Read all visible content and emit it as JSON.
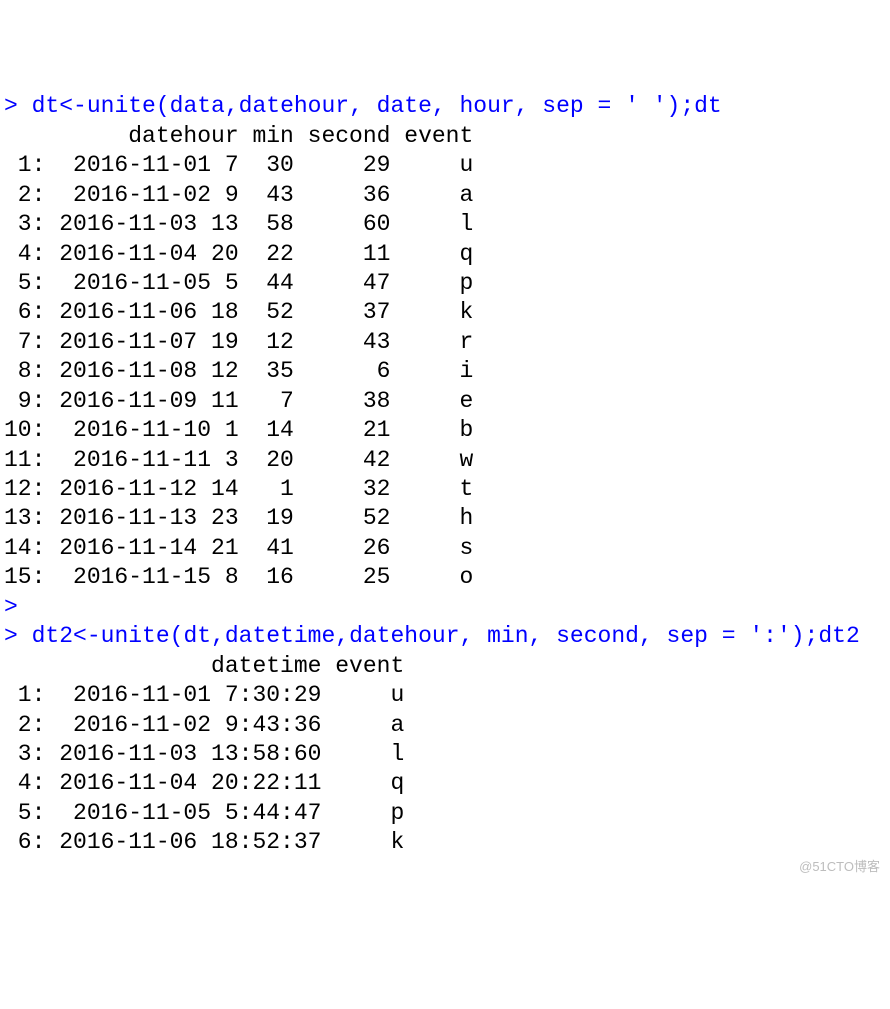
{
  "console": {
    "prompt": ">",
    "cmd1": "dt<-unite(data,datehour, date, hour, sep = ' ');dt",
    "header1": "         datehour min second event",
    "rows1": [
      {
        "idx": " 1:",
        "datehour": "  2016-11-01 7",
        "min": "30",
        "second": "29",
        "event": "u"
      },
      {
        "idx": " 2:",
        "datehour": "  2016-11-02 9",
        "min": "43",
        "second": "36",
        "event": "a"
      },
      {
        "idx": " 3:",
        "datehour": " 2016-11-03 13",
        "min": "58",
        "second": "60",
        "event": "l"
      },
      {
        "idx": " 4:",
        "datehour": " 2016-11-04 20",
        "min": "22",
        "second": "11",
        "event": "q"
      },
      {
        "idx": " 5:",
        "datehour": "  2016-11-05 5",
        "min": "44",
        "second": "47",
        "event": "p"
      },
      {
        "idx": " 6:",
        "datehour": " 2016-11-06 18",
        "min": "52",
        "second": "37",
        "event": "k"
      },
      {
        "idx": " 7:",
        "datehour": " 2016-11-07 19",
        "min": "12",
        "second": "43",
        "event": "r"
      },
      {
        "idx": " 8:",
        "datehour": " 2016-11-08 12",
        "min": "35",
        "second": " 6",
        "event": "i"
      },
      {
        "idx": " 9:",
        "datehour": " 2016-11-09 11",
        "min": " 7",
        "second": "38",
        "event": "e"
      },
      {
        "idx": "10:",
        "datehour": "  2016-11-10 1",
        "min": "14",
        "second": "21",
        "event": "b"
      },
      {
        "idx": "11:",
        "datehour": "  2016-11-11 3",
        "min": "20",
        "second": "42",
        "event": "w"
      },
      {
        "idx": "12:",
        "datehour": " 2016-11-12 14",
        "min": " 1",
        "second": "32",
        "event": "t"
      },
      {
        "idx": "13:",
        "datehour": " 2016-11-13 23",
        "min": "19",
        "second": "52",
        "event": "h"
      },
      {
        "idx": "14:",
        "datehour": " 2016-11-14 21",
        "min": "41",
        "second": "26",
        "event": "s"
      },
      {
        "idx": "15:",
        "datehour": "  2016-11-15 8",
        "min": "16",
        "second": "25",
        "event": "o"
      }
    ],
    "cmd2": "dt2<-unite(dt,datetime,datehour, min, second, sep = ':');dt2",
    "header2": "               datetime event",
    "rows2": [
      {
        "idx": " 1:",
        "datetime": "  2016-11-01 7:30:29",
        "event": "u"
      },
      {
        "idx": " 2:",
        "datetime": "  2016-11-02 9:43:36",
        "event": "a"
      },
      {
        "idx": " 3:",
        "datetime": " 2016-11-03 13:58:60",
        "event": "l"
      },
      {
        "idx": " 4:",
        "datetime": " 2016-11-04 20:22:11",
        "event": "q"
      },
      {
        "idx": " 5:",
        "datetime": "  2016-11-05 5:44:47",
        "event": "p"
      },
      {
        "idx": " 6:",
        "datetime": " 2016-11-06 18:52:37",
        "event": "k"
      }
    ]
  },
  "watermark": "@51CTO博客"
}
